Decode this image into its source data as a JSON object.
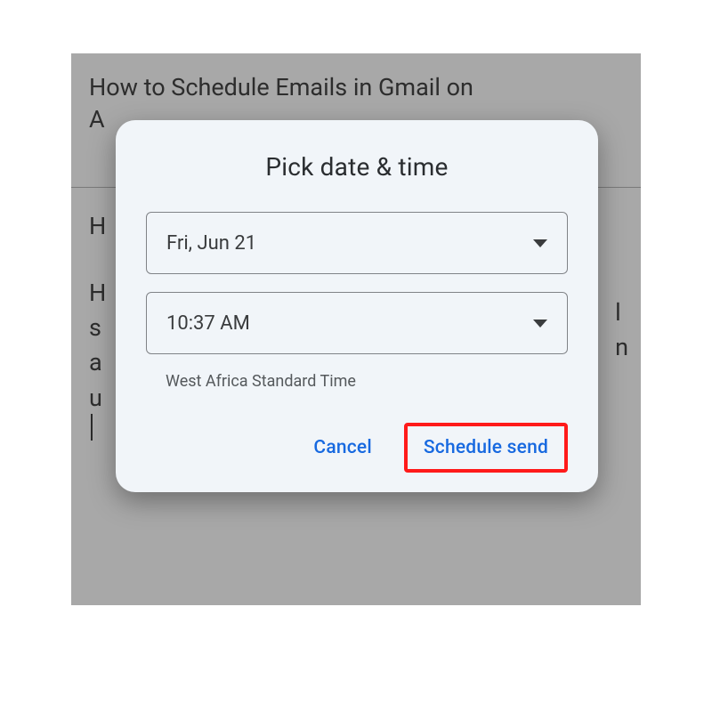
{
  "background": {
    "heading": "How to Schedule Emails in Gmail on",
    "heading_cont": "A",
    "body_h": "H",
    "body_rows": [
      "H",
      "s",
      "a",
      "u"
    ],
    "body_right": [
      "l",
      "",
      "n",
      ""
    ]
  },
  "dialog": {
    "title": "Pick date & time",
    "date_value": "Fri, Jun 21",
    "time_value": "10:37 AM",
    "timezone": "West Africa Standard Time",
    "cancel_label": "Cancel",
    "confirm_label": "Schedule send"
  }
}
